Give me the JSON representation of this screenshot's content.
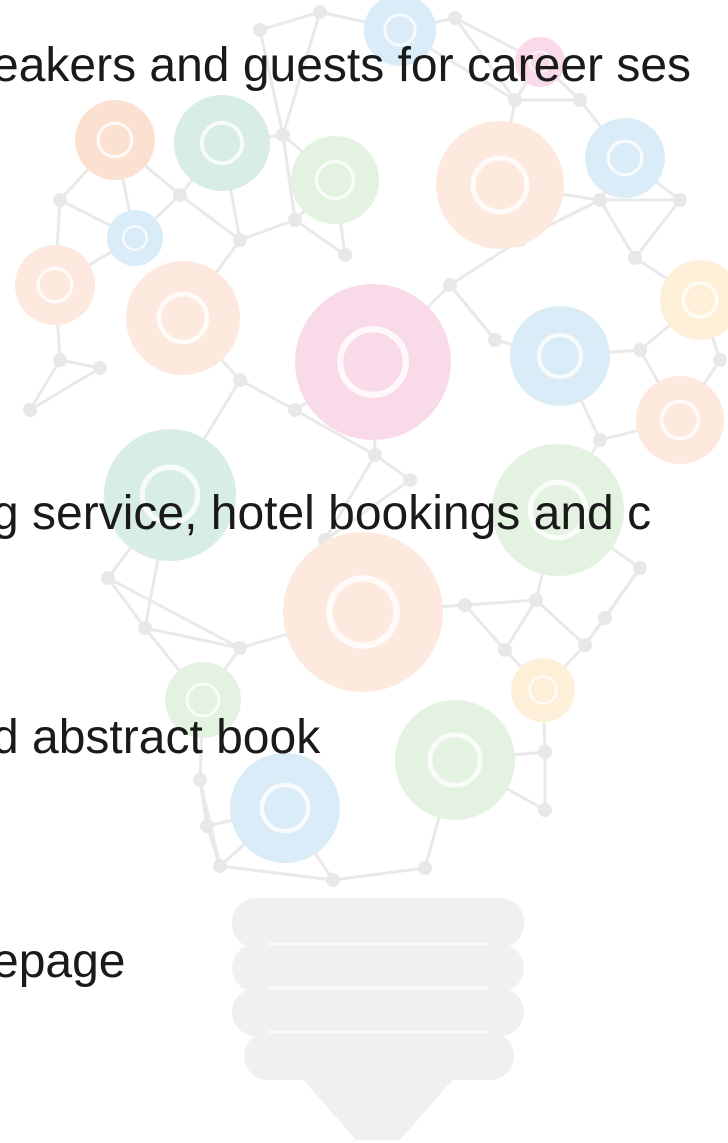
{
  "text_lines": [
    {
      "text": "eakers and guests for career ses"
    },
    {
      "text": "g service, hotel bookings and c"
    },
    {
      "text": "d abstract book"
    },
    {
      "text": "epage"
    }
  ],
  "background": {
    "illustration": "lightbulb-network-icon",
    "icons": [
      "radiation-icon",
      "document-icon",
      "test-tubes-icon",
      "molecule-icon",
      "globe-icon",
      "virus-icon",
      "telescope-icon",
      "gear-icon",
      "microscope-icon",
      "people-discussion-icon",
      "laptop-icon",
      "flask-icon",
      "dna-icon",
      "bacteria-icon",
      "microscope-icon",
      "brain-icon",
      "magnifier-icon",
      "list-icon",
      "mouse-icon",
      "cells-icon"
    ],
    "colors": {
      "orange": "#f7c9a8",
      "teal": "#b8ddd6",
      "green": "#cde7c8",
      "blue": "#bcdcf0",
      "pink": "#f5bcd6",
      "peach": "#fbd7c2",
      "yellow": "#fde3b8",
      "bulb_base": "#e6e6e6",
      "network_line": "#dddddd"
    }
  }
}
